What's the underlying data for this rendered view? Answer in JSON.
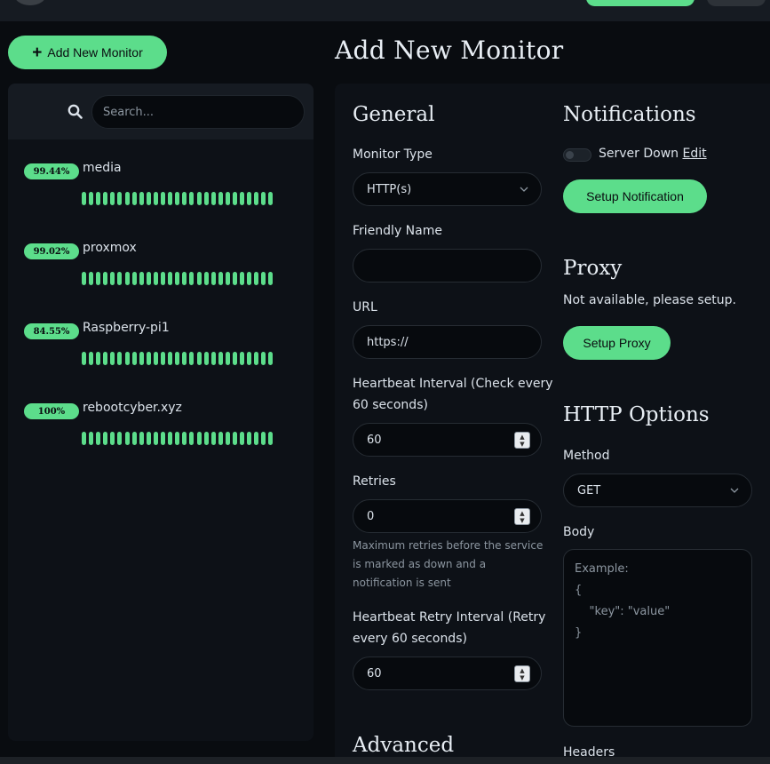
{
  "colors": {
    "accent": "#5cdd8b",
    "background": "#090c10",
    "card": "#0d1117"
  },
  "header": {
    "add_button_label": "Add New Monitor",
    "page_title": "Add New Monitor"
  },
  "search": {
    "placeholder": "Search..."
  },
  "monitors": [
    {
      "uptime": "99.44%",
      "name": "media",
      "heartbeat_bars": 27,
      "status": "up"
    },
    {
      "uptime": "99.02%",
      "name": "proxmox",
      "heartbeat_bars": 27,
      "status": "up"
    },
    {
      "uptime": "84.55%",
      "name": "Raspberry-pi1",
      "heartbeat_bars": 27,
      "status": "up"
    },
    {
      "uptime": "100%",
      "name": "rebootcyber.xyz",
      "heartbeat_bars": 27,
      "status": "up"
    }
  ],
  "general": {
    "title": "General",
    "monitor_type_label": "Monitor Type",
    "monitor_type_value": "HTTP(s)",
    "friendly_name_label": "Friendly Name",
    "friendly_name_value": "",
    "url_label": "URL",
    "url_value": "https://",
    "heartbeat_label_1": "Heartbeat Interval (Check every",
    "heartbeat_label_2": "60 seconds)",
    "heartbeat_value": "60",
    "retries_label": "Retries",
    "retries_value": "0",
    "retries_help_1": "Maximum retries before the service",
    "retries_help_2": "is marked as down and a",
    "retries_help_3": "notification is sent",
    "retry_interval_label_1": "Heartbeat Retry Interval (Retry",
    "retry_interval_label_2": "every 60 seconds)",
    "retry_interval_value": "60"
  },
  "advanced": {
    "title": "Advanced"
  },
  "notifications": {
    "title": "Notifications",
    "item_label": "Server Down",
    "item_enabled": false,
    "edit_label": "Edit",
    "setup_button": "Setup Notification"
  },
  "proxy": {
    "title": "Proxy",
    "message": "Not available, please setup.",
    "setup_button": "Setup Proxy"
  },
  "http_options": {
    "title": "HTTP Options",
    "method_label": "Method",
    "method_value": "GET",
    "body_label": "Body",
    "body_placeholder": "Example:\n{\n    \"key\": \"value\"\n}",
    "headers_label": "Headers"
  }
}
